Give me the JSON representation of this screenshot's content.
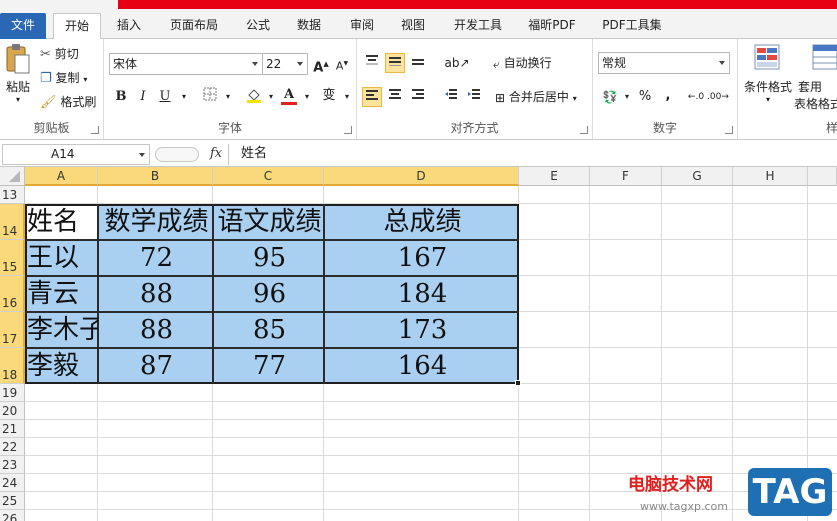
{
  "tabs": [
    {
      "label": "文件",
      "x": 0
    },
    {
      "label": "开始"
    },
    {
      "label": "插入"
    },
    {
      "label": "页面布局"
    },
    {
      "label": "公式"
    },
    {
      "label": "数据"
    },
    {
      "label": "审阅"
    },
    {
      "label": "视图"
    },
    {
      "label": "开发工具"
    },
    {
      "label": "福昕PDF"
    },
    {
      "label": "PDF工具集"
    }
  ],
  "clipboard": {
    "paste": "粘贴",
    "cut": "剪切",
    "copy": "复制",
    "format_painter": "格式刷",
    "group": "剪贴板"
  },
  "font": {
    "name": "宋体",
    "size": "22",
    "group": "字体",
    "bold": "B",
    "italic": "I",
    "underline": "U",
    "grow": "A",
    "shrink": "A"
  },
  "alignment": {
    "wrap": "自动换行",
    "merge": "合并后居中",
    "group": "对齐方式"
  },
  "number": {
    "format": "常规",
    "percent": "%",
    "comma": ",",
    "group": "数字"
  },
  "styles": {
    "conditional": "条件格式",
    "table_1": "套用",
    "table_2": "表格格式",
    "group": "样式"
  },
  "formula_bar": {
    "cell_ref": "A14",
    "fx": "fx",
    "content": "姓名"
  },
  "columns": [
    "A",
    "B",
    "C",
    "D",
    "E",
    "F",
    "G",
    "H"
  ],
  "rows": [
    "13",
    "14",
    "15",
    "16",
    "17",
    "18",
    "19",
    "20",
    "21",
    "22",
    "23",
    "24",
    "25",
    "26"
  ],
  "table": {
    "headers": [
      "姓名",
      "数学成绩",
      "语文成绩",
      "总成绩"
    ],
    "rows": [
      [
        "王以",
        "72",
        "95",
        "167"
      ],
      [
        "青云",
        "88",
        "96",
        "184"
      ],
      [
        "李木子",
        "88",
        "85",
        "173"
      ],
      [
        "李毅",
        "87",
        "77",
        "164"
      ]
    ]
  },
  "watermark": {
    "site": "电脑技术网",
    "url": "www.tagxp.com",
    "tag": "TAG"
  }
}
